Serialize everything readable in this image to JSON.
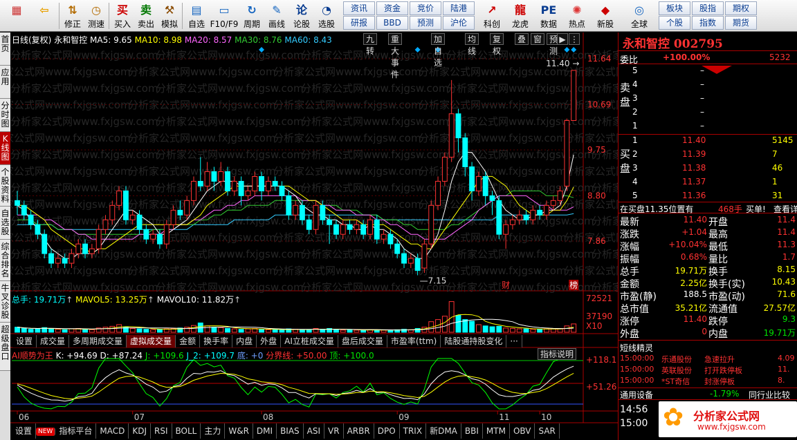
{
  "toolbar": {
    "items": [
      {
        "icon": "menu-grid",
        "label": ""
      },
      {
        "icon": "back-arrow",
        "label": ""
      },
      {
        "icon": "revise-arrows",
        "label": "修正"
      },
      {
        "icon": "clock",
        "label": "测速"
      },
      {
        "icon": "buy-tag",
        "label": "买入"
      },
      {
        "icon": "sell-tag",
        "label": "卖出"
      },
      {
        "icon": "hammer",
        "label": "模拟"
      },
      {
        "icon": "folder",
        "label": "自选"
      },
      {
        "icon": "window",
        "label": "F10/F9"
      },
      {
        "icon": "cycle",
        "label": "周期"
      },
      {
        "icon": "pen",
        "label": "画线"
      },
      {
        "icon": "discuss",
        "label": "论股"
      },
      {
        "icon": "stock-pick",
        "label": "选股"
      }
    ],
    "small_buttons": [
      [
        "资讯",
        "研报"
      ],
      [
        "资金",
        "BBD"
      ],
      [
        "竞价",
        "预测"
      ],
      [
        "陆港",
        "沪伦"
      ]
    ],
    "right_items": [
      {
        "icon": "profit",
        "label": "科创"
      },
      {
        "icon": "dragon",
        "label": "龙虎"
      },
      {
        "icon": "pe",
        "label": "数据"
      },
      {
        "icon": "hot",
        "label": "热点"
      },
      {
        "icon": "new",
        "label": "新股"
      },
      {
        "icon": "globe",
        "label": "全球"
      }
    ],
    "far_right": [
      [
        "板块",
        "个股"
      ],
      [
        "股指",
        "指数"
      ],
      [
        "期权",
        "期货"
      ]
    ]
  },
  "left_tabs": [
    "首页",
    "应用",
    "分时图",
    "K线图",
    "个股资料",
    "自选股",
    "综合排名",
    "牛叉诊股",
    "超级盘口"
  ],
  "chart_header": {
    "mode": "日线(复权)",
    "name": "永和智控",
    "ma5": "MA5: 9.65",
    "ma10": "MA10: 8.98",
    "ma20": "MA20: 8.57",
    "ma30": "MA30: 8.76",
    "ma60": "MA60: 8.43"
  },
  "chart_buttons": [
    "九转",
    "重大事件",
    "加自选",
    "均线",
    "复权",
    "叠",
    "窗",
    "预测"
  ],
  "price_axis": [
    "11.64",
    "10.69",
    "9.75",
    "8.80",
    "7.86"
  ],
  "annot": {
    "high": "11.40",
    "low": "7.15",
    "cai": "财",
    "bang": "榜"
  },
  "vol_header": {
    "label": "总手: 19.71万",
    "mavol5": "MAVOL5: 13.25万",
    "mavol10": "MAVOL10: 11.82万"
  },
  "vol_axis": [
    "72521",
    "37190",
    "X10"
  ],
  "ind_tabs": [
    "设置",
    "成交量",
    "多周期成交量",
    "虚拟成交量",
    "金额",
    "换手率",
    "内盘",
    "外盘",
    "AI立桩成交量",
    "盘后成交量",
    "市盈率(ttm)",
    "陆股通持股变化",
    "···"
  ],
  "ind_header": {
    "name": "AI顺势为王",
    "k": "K: +94.69",
    "d": "D: +87.24",
    "j": "J: +109.6",
    "j2": "J_2: +109.7",
    "di": "底: +0",
    "fjx": "分界线: +50.00",
    "ding": "顶: +100.0"
  },
  "ind_button": "指标说明",
  "ind_axis": [
    "+118.1",
    "+51.26"
  ],
  "months": [
    "06",
    "07",
    "08",
    "09",
    "10",
    "11"
  ],
  "bottom_tabs": [
    "设置",
    "NEW",
    "指标平台",
    "MACD",
    "KDJ",
    "RSI",
    "BOLL",
    "主力",
    "W&R",
    "DMI",
    "BIAS",
    "ASI",
    "VR",
    "ARBR",
    "DPO",
    "TRIX",
    "新DMA",
    "BBI",
    "MTM",
    "OBV",
    "SAR"
  ],
  "quote": {
    "title": "永和智控 002795",
    "weibi_label": "委比",
    "weibi": "+100.00%",
    "weibi_num": "5232",
    "sell": [
      {
        "n": "5",
        "p": "–"
      },
      {
        "n": "4",
        "p": "–"
      },
      {
        "n": "3",
        "p": "–"
      },
      {
        "n": "2",
        "p": "–"
      },
      {
        "n": "1",
        "p": "–"
      }
    ],
    "sell_side": "卖盘",
    "buy_side": "买盘",
    "buy": [
      {
        "n": "1",
        "p": "11.40",
        "v": "5145"
      },
      {
        "n": "2",
        "p": "11.39",
        "v": "7"
      },
      {
        "n": "3",
        "p": "11.38",
        "v": "46"
      },
      {
        "n": "4",
        "p": "11.37",
        "v": "1"
      },
      {
        "n": "5",
        "p": "11.36",
        "v": "31"
      }
    ],
    "notice": {
      "text": "在买盘11.35位置有",
      "vol": "468手",
      "act": "买单!",
      "link": "查看详"
    },
    "stats": [
      [
        "最新",
        "11.40",
        "开盘",
        "11.4"
      ],
      [
        "涨跌",
        "+1.04",
        "最高",
        "11.4"
      ],
      [
        "涨幅",
        "+10.04%",
        "最低",
        "11.3"
      ],
      [
        "振幅",
        "0.68%",
        "量比",
        "1.7"
      ],
      [
        "总手",
        "19.71万",
        "换手",
        "8.15"
      ],
      [
        "金额",
        "2.25亿",
        "换手(实)",
        "10.43"
      ],
      [
        "市盈(静)",
        "188.5",
        "市盈(动)",
        "71.6"
      ],
      [
        "总市值",
        "35.21亿",
        "流通值",
        "27.57亿"
      ],
      [
        "涨停",
        "11.40",
        "跌停",
        "9.3"
      ],
      [
        "外盘",
        "0",
        "内盘",
        "19.71万"
      ]
    ],
    "short_title": "短线精灵",
    "short": [
      [
        "15:00:00",
        "乐通股份",
        "急速拉升",
        "4.09"
      ],
      [
        "15:00:00",
        "英联股份",
        "打开跌停板",
        "11."
      ],
      [
        "15:00:00",
        "*ST奇信",
        "封涨停板",
        "8."
      ]
    ],
    "industry": {
      "name": "通用设备",
      "chg": "-1.79%",
      "cmp": "同行业比较"
    },
    "times": [
      "14:56",
      "15:00"
    ],
    "logo": "分析家公式网",
    "logo_url": "www.fxjgsw.com"
  },
  "watermark": "分析家公式网www.fxjgsw.com",
  "chart_data": {
    "type": "candlestick",
    "ylim": [
      7.0,
      11.9
    ],
    "candles": [
      [
        8.7,
        8.6,
        8.9,
        8.4
      ],
      [
        8.6,
        8.4,
        8.7,
        8.3
      ],
      [
        8.4,
        8.2,
        8.5,
        8.1
      ],
      [
        8.2,
        8.0,
        8.3,
        7.9
      ],
      [
        8.0,
        7.6,
        8.1,
        7.5
      ],
      [
        7.6,
        7.4,
        7.7,
        7.3
      ],
      [
        7.4,
        7.5,
        7.6,
        7.3
      ],
      [
        7.5,
        7.4,
        7.6,
        7.3
      ],
      [
        7.4,
        7.6,
        7.7,
        7.3
      ],
      [
        7.6,
        7.8,
        7.9,
        7.5
      ],
      [
        7.8,
        7.6,
        7.9,
        7.5
      ],
      [
        7.6,
        7.7,
        7.8,
        7.5
      ],
      [
        7.7,
        8.1,
        8.2,
        7.6
      ],
      [
        8.1,
        8.3,
        8.4,
        8.0
      ],
      [
        8.3,
        8.6,
        8.7,
        8.2
      ],
      [
        8.6,
        8.9,
        9.0,
        8.5
      ],
      [
        8.9,
        8.3,
        9.0,
        8.2
      ],
      [
        8.3,
        8.4,
        8.5,
        8.2
      ],
      [
        8.4,
        8.1,
        8.5,
        8.0
      ],
      [
        8.1,
        7.9,
        8.2,
        7.8
      ],
      [
        7.9,
        8.0,
        8.1,
        7.8
      ],
      [
        8.0,
        7.8,
        8.1,
        7.7
      ],
      [
        7.8,
        8.2,
        8.3,
        7.7
      ],
      [
        8.2,
        8.5,
        8.6,
        8.1
      ],
      [
        8.5,
        8.4,
        8.7,
        8.3
      ],
      [
        8.4,
        8.7,
        8.8,
        8.3
      ],
      [
        8.7,
        9.1,
        9.2,
        8.6
      ],
      [
        9.1,
        9.0,
        9.6,
        8.9
      ],
      [
        9.0,
        9.3,
        9.5,
        8.9
      ],
      [
        9.3,
        9.1,
        9.4,
        8.9
      ],
      [
        9.1,
        9.3,
        9.5,
        9.0
      ],
      [
        9.3,
        8.9,
        9.4,
        8.8
      ],
      [
        8.9,
        9.1,
        9.2,
        8.8
      ],
      [
        9.1,
        8.8,
        9.2,
        8.6
      ],
      [
        8.8,
        8.9,
        9.0,
        8.7
      ],
      [
        8.9,
        9.2,
        9.3,
        8.8
      ],
      [
        9.2,
        8.9,
        9.3,
        8.7
      ],
      [
        8.9,
        9.1,
        9.2,
        8.8
      ],
      [
        9.1,
        9.0,
        9.2,
        8.9
      ],
      [
        9.0,
        8.8,
        9.1,
        8.7
      ],
      [
        8.8,
        8.4,
        8.9,
        8.3
      ],
      [
        8.4,
        8.6,
        8.7,
        8.3
      ],
      [
        8.6,
        8.3,
        8.7,
        8.2
      ],
      [
        8.3,
        8.1,
        8.4,
        8.0
      ],
      [
        8.1,
        8.6,
        8.7,
        8.0
      ],
      [
        8.6,
        8.3,
        8.7,
        8.2
      ],
      [
        8.3,
        8.2,
        8.4,
        7.8
      ],
      [
        8.2,
        8.0,
        8.3,
        7.9
      ],
      [
        8.0,
        8.2,
        8.3,
        7.9
      ],
      [
        8.2,
        8.1,
        8.3,
        8.0
      ],
      [
        8.1,
        8.2,
        8.3,
        8.0
      ],
      [
        8.2,
        8.0,
        8.3,
        7.9
      ],
      [
        8.0,
        8.3,
        8.4,
        7.9
      ],
      [
        8.3,
        7.9,
        8.4,
        7.8
      ],
      [
        7.9,
        8.0,
        8.1,
        7.8
      ],
      [
        8.0,
        7.8,
        8.1,
        7.7
      ],
      [
        7.8,
        7.6,
        7.9,
        7.5
      ],
      [
        7.6,
        7.4,
        7.7,
        7.3
      ],
      [
        7.4,
        7.5,
        7.6,
        7.3
      ],
      [
        7.5,
        7.25,
        7.6,
        7.15
      ],
      [
        7.3,
        7.8,
        7.9,
        7.2
      ],
      [
        7.8,
        8.6,
        8.7,
        7.7
      ],
      [
        8.6,
        9.1,
        9.2,
        8.5
      ],
      [
        9.1,
        9.6,
        9.7,
        9.0
      ],
      [
        9.6,
        10.5,
        11.2,
        9.5
      ],
      [
        10.5,
        10.0,
        10.6,
        9.7
      ],
      [
        10.0,
        9.4,
        10.1,
        9.2
      ],
      [
        9.4,
        8.9,
        9.5,
        8.7
      ],
      [
        8.9,
        9.2,
        9.3,
        8.8
      ],
      [
        9.2,
        8.8,
        9.3,
        8.6
      ],
      [
        8.8,
        8.7,
        8.9,
        8.4
      ],
      [
        8.7,
        8.0,
        8.8,
        7.9
      ],
      [
        8.0,
        8.2,
        8.3,
        7.7
      ],
      [
        8.2,
        8.3,
        8.4,
        8.1
      ],
      [
        8.3,
        8.4,
        8.5,
        8.2
      ],
      [
        8.4,
        8.3,
        8.5,
        8.2
      ],
      [
        8.3,
        8.5,
        8.6,
        8.2
      ],
      [
        8.5,
        8.4,
        8.6,
        8.3
      ],
      [
        8.4,
        8.6,
        8.7,
        8.3
      ],
      [
        8.6,
        8.7,
        8.8,
        8.5
      ],
      [
        8.7,
        8.9,
        9.0,
        8.6
      ],
      [
        9.0,
        10.36,
        10.4,
        8.9
      ],
      [
        10.36,
        11.4,
        11.4,
        10.36
      ]
    ],
    "ma5": [
      8.6,
      8.5,
      8.3,
      8.1,
      7.9,
      7.7,
      7.6,
      7.5,
      7.5,
      7.6,
      7.6,
      7.6,
      7.7,
      7.9,
      8.1,
      8.3,
      8.5,
      8.5,
      8.4,
      8.3,
      8.2,
      8.0,
      8.0,
      8.1,
      8.2,
      8.3,
      8.5,
      8.7,
      8.9,
      9.0,
      9.1,
      9.1,
      9.1,
      9.0,
      9.0,
      9.0,
      9.0,
      9.0,
      9.0,
      9.0,
      8.9,
      8.8,
      8.6,
      8.5,
      8.4,
      8.4,
      8.3,
      8.3,
      8.2,
      8.2,
      8.1,
      8.1,
      8.2,
      8.1,
      8.1,
      8.0,
      7.9,
      7.7,
      7.6,
      7.5,
      7.5,
      7.7,
      8.0,
      8.5,
      9.1,
      9.5,
      9.7,
      9.7,
      9.5,
      9.3,
      9.0,
      8.7,
      8.5,
      8.4,
      8.3,
      8.3,
      8.4,
      8.4,
      8.5,
      8.5,
      8.6,
      9.0,
      9.65
    ],
    "ma10": [
      8.6,
      8.6,
      8.5,
      8.4,
      8.3,
      8.1,
      8.0,
      7.9,
      7.8,
      7.7,
      7.7,
      7.6,
      7.7,
      7.7,
      7.8,
      7.9,
      8.0,
      8.1,
      8.2,
      8.2,
      8.2,
      8.2,
      8.2,
      8.2,
      8.2,
      8.2,
      8.3,
      8.4,
      8.6,
      8.7,
      8.8,
      8.9,
      9.0,
      9.0,
      9.0,
      9.0,
      9.0,
      9.0,
      9.0,
      9.0,
      9.0,
      8.9,
      8.8,
      8.7,
      8.7,
      8.6,
      8.5,
      8.4,
      8.3,
      8.3,
      8.3,
      8.2,
      8.2,
      8.2,
      8.2,
      8.1,
      8.0,
      7.9,
      7.8,
      7.8,
      7.7,
      7.7,
      7.9,
      8.1,
      8.3,
      8.5,
      8.7,
      8.9,
      9.1,
      9.2,
      9.2,
      9.1,
      9.0,
      8.8,
      8.6,
      8.5,
      8.4,
      8.4,
      8.4,
      8.5,
      8.5,
      8.7,
      8.98
    ],
    "ma20": [
      8.4,
      8.4,
      8.4,
      8.4,
      8.3,
      8.3,
      8.2,
      8.1,
      8.1,
      8.0,
      8.0,
      7.9,
      7.9,
      7.9,
      7.9,
      7.9,
      7.9,
      7.9,
      8.0,
      8.0,
      8.0,
      8.0,
      8.1,
      8.1,
      8.2,
      8.2,
      8.3,
      8.3,
      8.4,
      8.5,
      8.5,
      8.6,
      8.6,
      8.7,
      8.7,
      8.8,
      8.8,
      8.8,
      8.8,
      8.8,
      8.8,
      8.8,
      8.7,
      8.7,
      8.7,
      8.6,
      8.6,
      8.5,
      8.5,
      8.5,
      8.4,
      8.4,
      8.4,
      8.3,
      8.3,
      8.2,
      8.2,
      8.1,
      8.0,
      8.0,
      7.9,
      7.9,
      7.9,
      7.9,
      8.0,
      8.1,
      8.2,
      8.3,
      8.5,
      8.6,
      8.7,
      8.8,
      8.8,
      8.8,
      8.8,
      8.8,
      8.7,
      8.6,
      8.6,
      8.5,
      8.5,
      8.5,
      8.57
    ],
    "ma30": [
      8.3,
      8.3,
      8.3,
      8.2,
      8.2,
      8.2,
      8.1,
      8.1,
      8.1,
      8.0,
      8.0,
      8.0,
      8.0,
      8.0,
      8.0,
      8.0,
      8.0,
      8.0,
      8.0,
      8.0,
      8.1,
      8.1,
      8.1,
      8.1,
      8.2,
      8.2,
      8.2,
      8.3,
      8.3,
      8.4,
      8.4,
      8.5,
      8.5,
      8.5,
      8.6,
      8.6,
      8.6,
      8.6,
      8.7,
      8.7,
      8.7,
      8.7,
      8.7,
      8.7,
      8.7,
      8.6,
      8.6,
      8.6,
      8.5,
      8.5,
      8.5,
      8.4,
      8.4,
      8.4,
      8.3,
      8.3,
      8.3,
      8.2,
      8.2,
      8.1,
      8.1,
      8.1,
      8.1,
      8.1,
      8.2,
      8.2,
      8.3,
      8.4,
      8.5,
      8.6,
      8.7,
      8.8,
      8.8,
      8.9,
      8.9,
      8.9,
      8.9,
      8.9,
      8.8,
      8.8,
      8.8,
      8.8,
      8.76
    ],
    "ma60": [
      8.2,
      8.2,
      8.2,
      8.2,
      8.2,
      8.2,
      8.1,
      8.1,
      8.1,
      8.1,
      8.1,
      8.1,
      8.1,
      8.1,
      8.1,
      8.1,
      8.1,
      8.1,
      8.1,
      8.1,
      8.1,
      8.1,
      8.1,
      8.1,
      8.1,
      8.1,
      8.2,
      8.2,
      8.2,
      8.2,
      8.2,
      8.2,
      8.3,
      8.3,
      8.3,
      8.3,
      8.3,
      8.3,
      8.4,
      8.4,
      8.4,
      8.4,
      8.4,
      8.4,
      8.4,
      8.4,
      8.4,
      8.4,
      8.4,
      8.4,
      8.4,
      8.4,
      8.4,
      8.4,
      8.3,
      8.3,
      8.3,
      8.3,
      8.3,
      8.3,
      8.3,
      8.3,
      8.3,
      8.3,
      8.3,
      8.3,
      8.3,
      8.3,
      8.3,
      8.3,
      8.3,
      8.4,
      8.4,
      8.4,
      8.4,
      8.4,
      8.4,
      8.4,
      8.4,
      8.4,
      8.4,
      8.4,
      8.43
    ],
    "volume_ylim": [
      0,
      80000
    ],
    "vol_pattern": [
      12000,
      9000,
      7000,
      8000,
      11000,
      9000,
      7000,
      6000,
      8000,
      9000,
      7000,
      6000,
      10000,
      12000,
      14000,
      18000,
      12000,
      9000,
      8000,
      7000,
      6000,
      7000,
      8000,
      9000,
      10000,
      12000,
      16000,
      22000,
      15000,
      12000,
      11000,
      9000,
      8000,
      7000,
      8000,
      9000,
      7000,
      6000,
      6000,
      5000,
      8000,
      7000,
      6000,
      6000,
      9000,
      7000,
      9000,
      6000,
      5000,
      6000,
      5000,
      5000,
      6000,
      5000,
      5000,
      5000,
      6000,
      7000,
      6000,
      9000,
      12000,
      25000,
      30000,
      38000,
      72521,
      40000,
      30000,
      26000,
      18000,
      15000,
      13000,
      14000,
      10000,
      9000,
      8000,
      8000,
      7000,
      7000,
      8000,
      8000,
      9000,
      15000,
      19710
    ]
  }
}
